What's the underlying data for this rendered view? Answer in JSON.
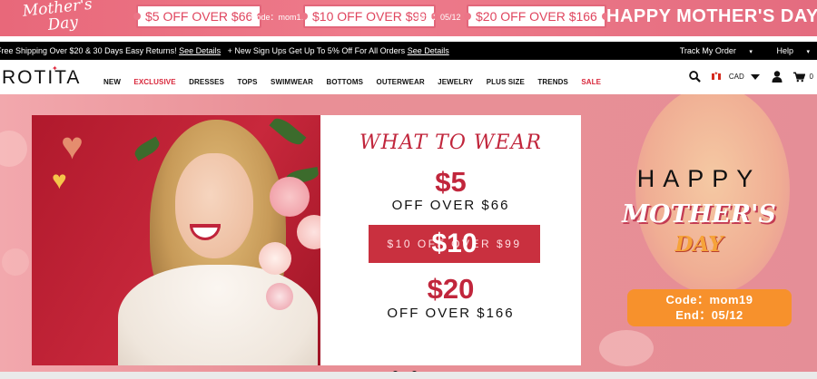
{
  "promo": {
    "script_line1": "Mother's",
    "script_line2": "Day",
    "coupons": [
      {
        "label": "$5 OFF OVER $66"
      },
      {
        "label": "$10 OFF OVER $99"
      },
      {
        "label": "$20 OFF OVER $166"
      }
    ],
    "code_text": "Code：mom19",
    "end_text": "End：05/12",
    "headline": "HAPPY MOTHER'S DAY"
  },
  "infobar": {
    "message_1": "Free Shipping Over $20 & 30 Days Easy Returns!",
    "link_1": "See Details",
    "message_2": "+ New Sign Ups Get Up To 5% Off For All Orders",
    "link_2": "See Details",
    "track_order": "Track My Order",
    "help": "Help"
  },
  "nav": {
    "logo": "ROTITA",
    "menu": [
      "NEW",
      "EXCLUSIVE",
      "DRESSES",
      "TOPS",
      "SWIMWEAR",
      "BOTTOMS",
      "OUTERWEAR",
      "JEWELRY",
      "PLUS SIZE",
      "TRENDS",
      "SALE"
    ],
    "currency": "CAD",
    "cart_count": "0"
  },
  "hero": {
    "card": {
      "title": "WHAT TO WEAR",
      "offer1_amount": "$5",
      "offer1_text": "OFF OVER $66",
      "offer2_amount": "$10",
      "offer2_text": "$10 OFF OVER $99",
      "offer3_amount": "$20",
      "offer3_text": "OFF OVER $166"
    },
    "right": {
      "happy": "HAPPY",
      "mothers": "MOTHER'S",
      "day": "DAY",
      "code": "Code：mom19",
      "end": "End：05/12"
    },
    "carousel": {
      "slides": 2,
      "active": 1
    }
  },
  "colors": {
    "accent_red": "#c1263c",
    "promo_pink": "#ee7b8b",
    "orange": "#f7912c"
  }
}
